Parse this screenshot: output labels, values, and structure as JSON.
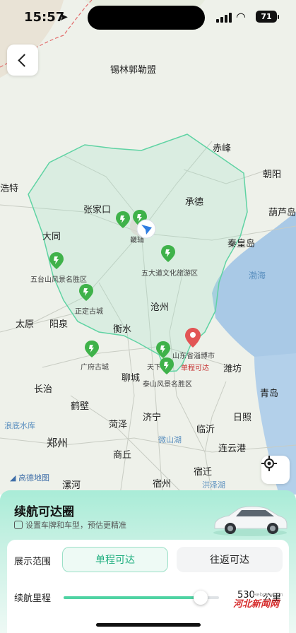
{
  "status": {
    "time": "15:57",
    "battery": "71"
  },
  "map": {
    "labels": {
      "xilinguole": "锡林郭勒盟",
      "chifeng": "赤峰",
      "chaoyang": "朝阳",
      "haote": "浩特",
      "zhangjiakou": "张家口",
      "chengde": "承德",
      "huludao": "葫芦岛",
      "datong": "大同",
      "jingjin": "畿辅",
      "qinhuangdao": "秦皇岛",
      "wutaishan": "五台山风景名胜区",
      "wudadao": "五大道文化旅游区",
      "bohai": "渤海",
      "zhengding": "正定古城",
      "cangzhou": "沧州",
      "taiyuan": "太原",
      "yangquan": "阳泉",
      "hengshui": "衡水",
      "zibo": "山东省淄博市",
      "guangfu": "广府古城",
      "tianxia": "天下",
      "liaocheng": "聊城",
      "danchengkeda": "单程可达",
      "weifang": "潍坊",
      "taishan": "泰山风景名胜区",
      "changzhi": "长治",
      "qingdao": "青岛",
      "hebi": "鹤壁",
      "jining": "济宁",
      "rizhao": "日照",
      "langhuashuiku": "浪底水库",
      "heze": "菏泽",
      "linyi": "临沂",
      "zhengzhou": "郑州",
      "weishanhu": "微山湖",
      "lianyungang": "连云港",
      "shangqiu": "商丘",
      "suqian": "宿迁",
      "luohe": "漯河",
      "suzhou": "宿州",
      "hongzehu": "洪泽湖"
    },
    "attribution": "高德地图"
  },
  "panel": {
    "title": "续航可达圈",
    "subtitle": "设置车牌和车型，预估更精准",
    "display_label": "展示范围",
    "tab_single": "单程可达",
    "tab_round": "往返可达",
    "range_label": "续航里程",
    "range_value": "530",
    "range_unit": "公里",
    "slider_fraction": 0.88
  },
  "watermark": {
    "logo": "河北新闻网",
    "url": "Hebnews.cn"
  },
  "colors": {
    "accent": "#1eae7e",
    "reach_area": "#7ed9b4",
    "ev_pin": "#3fb24a"
  }
}
